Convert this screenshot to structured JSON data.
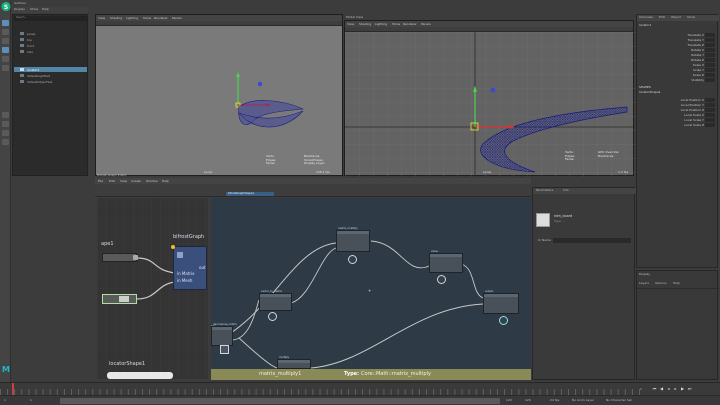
{
  "app": {
    "logo_icon": "maya-logo-icon",
    "accent": "#5285a6"
  },
  "outliner": {
    "title": "Outliner",
    "menu": [
      "Display",
      "Show",
      "Help"
    ],
    "search_placeholder": "Search...",
    "items": [
      {
        "label": "persp",
        "icon": "camera-icon"
      },
      {
        "label": "top",
        "icon": "camera-icon"
      },
      {
        "label": "front",
        "icon": "camera-icon"
      },
      {
        "label": "side",
        "icon": "camera-icon"
      },
      {
        "label": "locator1",
        "icon": "locator-icon",
        "selected": true
      },
      {
        "label": "defaultLightSet",
        "icon": "set-icon"
      },
      {
        "label": "defaultObjectSet",
        "icon": "set-icon"
      }
    ]
  },
  "viewport_left": {
    "menu": [
      "View",
      "Shading",
      "Lighting",
      "Show",
      "Renderer",
      "Panels"
    ],
    "hud": {
      "labels": [
        "Verts:",
        "Edges:",
        "Faces:",
        "Tris:",
        "UVs:"
      ],
      "cols": [
        "",
        "",
        ""
      ],
      "right": [
        "Backfaces:",
        "Smoothness:",
        "Instance:",
        "Display Layer:",
        "Distance From Camera:",
        "Selected Objects:"
      ],
      "camera": "persp",
      "fps": "108.1 fps"
    }
  },
  "viewport_right": {
    "title": "Model View",
    "menu": [
      "View",
      "Shading",
      "Lighting",
      "Show",
      "Renderer",
      "Panels"
    ],
    "hud": {
      "camera": "persp",
      "fps": "1.2 fps",
      "labels": [
        "Verts:",
        "Edges:",
        "Faces:",
        "Tris:",
        "UVs:"
      ],
      "right": [
        "GPU Override:",
        "Backfaces:"
      ]
    }
  },
  "channel_box": {
    "tabs": [
      "Channels",
      "Edit",
      "Object",
      "Show"
    ],
    "object": "locator1",
    "channels": [
      "Translate X",
      "Translate Y",
      "Translate Z",
      "Rotate X",
      "Rotate Y",
      "Rotate Z",
      "Scale X",
      "Scale Y",
      "Scale Z",
      "Visibility"
    ],
    "shape_header": "SHAPES",
    "shape": "locatorShape1",
    "shape_channels": [
      "Local Position X",
      "Local Position Y",
      "Local Position Z",
      "Local Scale X",
      "Local Scale Y",
      "Local Scale Z"
    ]
  },
  "graph_editor": {
    "title": "Bifrost Graph Editor",
    "menu": [
      "File",
      "Edit",
      "View",
      "Create",
      "Window",
      "Help"
    ],
    "breadcrumb": "bifrostGraphShape1",
    "zoom_panel": {
      "node_title": "bifrostGraph",
      "inputs": [
        "in Matrix",
        "in Mesh"
      ],
      "out_label": "out",
      "left_node": "ape1",
      "bottom_node": "locatorShape1"
    },
    "nodes": [
      {
        "id": "n1",
        "title": "matrix_multiply"
      },
      {
        "id": "n2",
        "title": "value"
      },
      {
        "id": "n3",
        "title": "vector_to_matrix"
      },
      {
        "id": "n4",
        "title": "output"
      },
      {
        "id": "n5",
        "title": "decompose_matrix"
      },
      {
        "id": "n6",
        "title": "multiply"
      },
      {
        "id": "n7",
        "title": "add"
      }
    ],
    "status_node": "matrix_multiply1",
    "status_type_label": "Type:",
    "status_type": "Core::Math::matrix_multiply"
  },
  "attribute_panel": {
    "title": "Parameters",
    "tab": "Info",
    "node_name": "rdm_board",
    "node_type": "Type: ...",
    "field_label": "Ui Name",
    "field_value": ""
  },
  "lower_right": {
    "title": "Display",
    "tabs": [
      "Layers",
      "Options",
      "Help"
    ]
  },
  "timeline": {
    "start": "1",
    "end": "120",
    "current": "1",
    "range_start": "1",
    "range_end": "120",
    "fps_label": "24 fps",
    "anim_layer": "No Anim Layer",
    "char_set": "No Character Set"
  }
}
